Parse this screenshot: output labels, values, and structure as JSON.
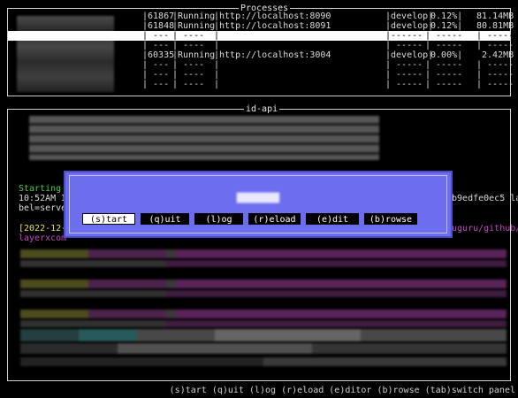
{
  "processes_panel": {
    "title": "Processes",
    "rows": [
      {
        "pid": "|61867",
        "status": "|Running",
        "url": "|http://localhost:8090",
        "branch": "|develop|",
        "cpu": " 0.12%|",
        "mem": "81.14MB",
        "selected": false
      },
      {
        "pid": "|61848",
        "status": "|Running",
        "url": "|http://localhost:8091",
        "branch": "|develop|",
        "cpu": " 0.12%|",
        "mem": "80.81MB",
        "selected": false
      },
      {
        "pid": "| ---",
        "status": "| ----",
        "url": "|",
        "branch": "|------",
        "cpu": "| -----",
        "mem": "| -----",
        "selected": true
      },
      {
        "pid": "| ---",
        "status": "| ----",
        "url": "|",
        "branch": "| -----",
        "cpu": "| -----",
        "mem": "| -----",
        "selected": false
      },
      {
        "pid": "|60335",
        "status": "|Running",
        "url": "|http://localhost:3004",
        "branch": "|develop|",
        "cpu": " 0.00%|",
        "mem": " 2.42MB",
        "selected": false
      },
      {
        "pid": "| ---",
        "status": "| ----",
        "url": "|",
        "branch": "| -----",
        "cpu": "| -----",
        "mem": "| -----",
        "selected": false
      },
      {
        "pid": "| ---",
        "status": "| ----",
        "url": "|",
        "branch": "| -----",
        "cpu": "| -----",
        "mem": "| -----",
        "selected": false
      },
      {
        "pid": "| ---",
        "status": "| ----",
        "url": "|",
        "branch": "| -----",
        "cpu": "| -----",
        "mem": "| -----",
        "selected": false
      }
    ]
  },
  "log_panel": {
    "title": "id-api",
    "lines": {
      "starting": "Starting",
      "time": "10:52AM I",
      "hash": "bb9edfe0ec5 la",
      "bel": "bel=serve",
      "date": "[2022-12-",
      "path": "suguru/github/",
      "layer": "layerxcom"
    }
  },
  "dialog": {
    "buttons": [
      "(s)tart",
      "(q)uit",
      "(l)og",
      "(r)eload",
      "(e)dit",
      "(b)rowse"
    ],
    "active_index": 0
  },
  "status_bar": {
    "text": "(s)tart (q)uit (l)og (r)eload (e)ditor (b)rowse (tab)switch panel"
  }
}
